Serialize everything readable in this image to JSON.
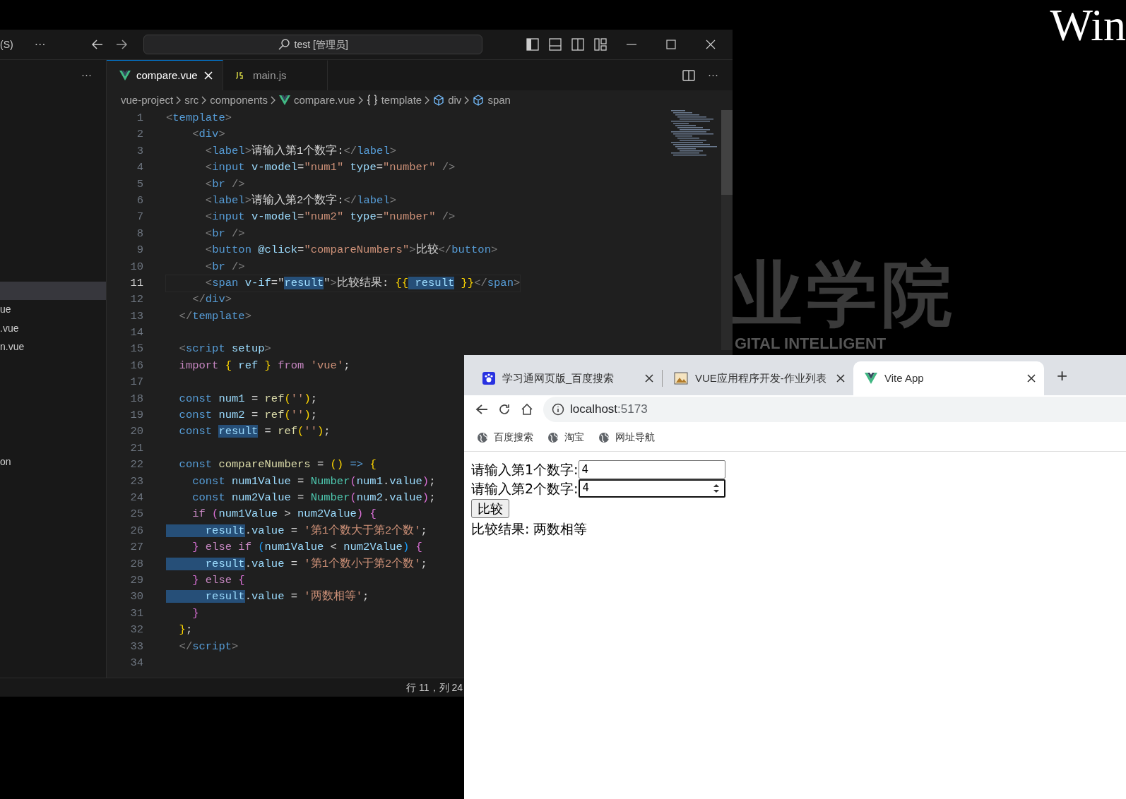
{
  "desktop": {
    "wallpaper_texts": [
      {
        "kind": "title",
        "text": "Win"
      },
      {
        "kind": "big",
        "text": "业学院"
      },
      {
        "kind": "sub",
        "text": "GITAL INTELLIGENT"
      }
    ]
  },
  "editor_window": {
    "menu_text": "(S)",
    "more": "···",
    "search": "test [管理员]",
    "sidebar": {
      "more": "···",
      "files": [
        {
          "label": "ue"
        },
        {
          "label": ".vue"
        },
        {
          "label": "n.vue"
        }
      ],
      "outline": [
        {
          "label": "on"
        }
      ]
    },
    "tabs": [
      {
        "label": "compare.vue",
        "kind": "vue",
        "selected": true
      },
      {
        "label": "main.js",
        "kind": "js",
        "selected": false
      }
    ],
    "tab_more": "···",
    "breadcrumb": [
      {
        "label": "vue-project",
        "kind": "folder"
      },
      {
        "label": "src",
        "kind": "folder"
      },
      {
        "label": "components",
        "kind": "folder"
      },
      {
        "label": "compare.vue",
        "kind": "vue"
      },
      {
        "label": "template",
        "kind": "braces"
      },
      {
        "label": "div",
        "kind": "element"
      },
      {
        "label": "span",
        "kind": "element"
      }
    ],
    "lines": [
      {
        "number": "1",
        "current": false,
        "tokens": [
          {
            "kind": "punct",
            "text": "<"
          },
          {
            "kind": "tag",
            "text": "template"
          },
          {
            "kind": "punct",
            "text": ">"
          }
        ]
      },
      {
        "number": "2",
        "current": false,
        "tokens": [
          {
            "kind": "punct",
            "text": "    <"
          },
          {
            "kind": "tag",
            "text": "div"
          },
          {
            "kind": "punct",
            "text": ">"
          }
        ]
      },
      {
        "number": "3",
        "current": false,
        "tokens": [
          {
            "kind": "punct",
            "text": "      <"
          },
          {
            "kind": "tag",
            "text": "label"
          },
          {
            "kind": "punct",
            "text": ">"
          },
          {
            "kind": "text",
            "text": "请输入第1个数字:"
          },
          {
            "kind": "punct",
            "text": "</"
          },
          {
            "kind": "tag",
            "text": "label"
          },
          {
            "kind": "punct",
            "text": ">"
          }
        ]
      },
      {
        "number": "4",
        "current": false,
        "tokens": [
          {
            "kind": "punct",
            "text": "      <"
          },
          {
            "kind": "tag",
            "text": "input"
          },
          {
            "kind": "attr",
            "text": " v-model"
          },
          {
            "kind": "plain",
            "text": "="
          },
          {
            "kind": "str",
            "text": "\"num1\""
          },
          {
            "kind": "attr",
            "text": " type"
          },
          {
            "kind": "plain",
            "text": "="
          },
          {
            "kind": "str",
            "text": "\"number\""
          },
          {
            "kind": "punct",
            "text": " />"
          }
        ]
      },
      {
        "number": "5",
        "current": false,
        "tokens": [
          {
            "kind": "punct",
            "text": "      <"
          },
          {
            "kind": "tag",
            "text": "br"
          },
          {
            "kind": "punct",
            "text": " />"
          }
        ]
      },
      {
        "number": "6",
        "current": false,
        "tokens": [
          {
            "kind": "punct",
            "text": "      <"
          },
          {
            "kind": "tag",
            "text": "label"
          },
          {
            "kind": "punct",
            "text": ">"
          },
          {
            "kind": "text",
            "text": "请输入第2个数字:"
          },
          {
            "kind": "punct",
            "text": "</"
          },
          {
            "kind": "tag",
            "text": "label"
          },
          {
            "kind": "punct",
            "text": ">"
          }
        ]
      },
      {
        "number": "7",
        "current": false,
        "tokens": [
          {
            "kind": "punct",
            "text": "      <"
          },
          {
            "kind": "tag",
            "text": "input"
          },
          {
            "kind": "attr",
            "text": " v-model"
          },
          {
            "kind": "plain",
            "text": "="
          },
          {
            "kind": "str",
            "text": "\"num2\""
          },
          {
            "kind": "attr",
            "text": " type"
          },
          {
            "kind": "plain",
            "text": "="
          },
          {
            "kind": "str",
            "text": "\"number\""
          },
          {
            "kind": "punct",
            "text": " />"
          }
        ]
      },
      {
        "number": "8",
        "current": false,
        "tokens": [
          {
            "kind": "punct",
            "text": "      <"
          },
          {
            "kind": "tag",
            "text": "br"
          },
          {
            "kind": "punct",
            "text": " />"
          }
        ]
      },
      {
        "number": "9",
        "current": false,
        "tokens": [
          {
            "kind": "punct",
            "text": "      <"
          },
          {
            "kind": "tag",
            "text": "button"
          },
          {
            "kind": "attr",
            "text": " @click"
          },
          {
            "kind": "plain",
            "text": "="
          },
          {
            "kind": "str",
            "text": "\"compareNumbers\""
          },
          {
            "kind": "punct",
            "text": ">"
          },
          {
            "kind": "text",
            "text": "比较"
          },
          {
            "kind": "punct",
            "text": "</"
          },
          {
            "kind": "tag",
            "text": "button"
          },
          {
            "kind": "punct",
            "text": ">"
          }
        ]
      },
      {
        "number": "10",
        "current": false,
        "tokens": [
          {
            "kind": "punct",
            "text": "      <"
          },
          {
            "kind": "tag",
            "text": "br"
          },
          {
            "kind": "punct",
            "text": " />"
          }
        ]
      },
      {
        "number": "11",
        "current": true,
        "tokens": [
          {
            "kind": "punct",
            "text": "      <"
          },
          {
            "kind": "tag",
            "text": "span"
          },
          {
            "kind": "attr",
            "text": " v-if"
          },
          {
            "kind": "plain",
            "text": "=\""
          },
          {
            "kind": "match",
            "text": "result"
          },
          {
            "kind": "plain",
            "text": "\""
          },
          {
            "kind": "punct",
            "text": ">"
          },
          {
            "kind": "text",
            "text": "比较结果: "
          },
          {
            "kind": "br1",
            "text": "{{"
          },
          {
            "kind": "match",
            "text": " result"
          },
          {
            "kind": "br1",
            "text": " }}"
          },
          {
            "kind": "punct",
            "text": "</"
          },
          {
            "kind": "tag",
            "text": "span"
          },
          {
            "kind": "punct",
            "text": ">"
          }
        ]
      },
      {
        "number": "12",
        "current": false,
        "tokens": [
          {
            "kind": "punct",
            "text": "    </"
          },
          {
            "kind": "tag",
            "text": "div"
          },
          {
            "kind": "punct",
            "text": ">"
          }
        ]
      },
      {
        "number": "13",
        "current": false,
        "tokens": [
          {
            "kind": "punct",
            "text": "  </"
          },
          {
            "kind": "tag",
            "text": "template"
          },
          {
            "kind": "punct",
            "text": ">"
          }
        ]
      },
      {
        "number": "14",
        "current": false
      },
      {
        "number": "15",
        "current": false,
        "tokens": [
          {
            "kind": "punct",
            "text": "  <"
          },
          {
            "kind": "tag",
            "text": "script"
          },
          {
            "kind": "attr",
            "text": " setup"
          },
          {
            "kind": "punct",
            "text": ">"
          }
        ]
      },
      {
        "number": "16",
        "current": false,
        "tokens": [
          {
            "kind": "ctrl",
            "text": "  import"
          },
          {
            "kind": "br1",
            "text": " {"
          },
          {
            "kind": "var",
            "text": " ref"
          },
          {
            "kind": "br1",
            "text": " }"
          },
          {
            "kind": "ctrl",
            "text": " from"
          },
          {
            "kind": "str",
            "text": " 'vue'"
          },
          {
            "kind": "plain",
            "text": ";"
          }
        ]
      },
      {
        "number": "17",
        "current": false
      },
      {
        "number": "18",
        "current": false,
        "tokens": [
          {
            "kind": "kw",
            "text": "  const"
          },
          {
            "kind": "var",
            "text": " num1"
          },
          {
            "kind": "plain",
            "text": " = "
          },
          {
            "kind": "fn",
            "text": "ref"
          },
          {
            "kind": "br1",
            "text": "("
          },
          {
            "kind": "str",
            "text": "''"
          },
          {
            "kind": "br1",
            "text": ")"
          },
          {
            "kind": "plain",
            "text": ";"
          }
        ]
      },
      {
        "number": "19",
        "current": false,
        "tokens": [
          {
            "kind": "kw",
            "text": "  const"
          },
          {
            "kind": "var",
            "text": " num2"
          },
          {
            "kind": "plain",
            "text": " = "
          },
          {
            "kind": "fn",
            "text": "ref"
          },
          {
            "kind": "br1",
            "text": "("
          },
          {
            "kind": "str",
            "text": "''"
          },
          {
            "kind": "br1",
            "text": ")"
          },
          {
            "kind": "plain",
            "text": ";"
          }
        ]
      },
      {
        "number": "20",
        "current": false,
        "tokens": [
          {
            "kind": "kw",
            "text": "  const "
          },
          {
            "kind": "match",
            "text": "result"
          },
          {
            "kind": "plain",
            "text": " = "
          },
          {
            "kind": "fn",
            "text": "ref"
          },
          {
            "kind": "br1",
            "text": "("
          },
          {
            "kind": "str",
            "text": "''"
          },
          {
            "kind": "br1",
            "text": ")"
          },
          {
            "kind": "plain",
            "text": ";"
          }
        ]
      },
      {
        "number": "21",
        "current": false
      },
      {
        "number": "22",
        "current": false,
        "tokens": [
          {
            "kind": "kw",
            "text": "  const"
          },
          {
            "kind": "fn",
            "text": " compareNumbers"
          },
          {
            "kind": "plain",
            "text": " = "
          },
          {
            "kind": "br1",
            "text": "()"
          },
          {
            "kind": "kw",
            "text": " =>"
          },
          {
            "kind": "br1",
            "text": " {"
          }
        ]
      },
      {
        "number": "23",
        "current": false,
        "tokens": [
          {
            "kind": "kw",
            "text": "    const"
          },
          {
            "kind": "var",
            "text": " num1Value"
          },
          {
            "kind": "plain",
            "text": " = "
          },
          {
            "kind": "cls",
            "text": "Number"
          },
          {
            "kind": "br2",
            "text": "("
          },
          {
            "kind": "var",
            "text": "num1"
          },
          {
            "kind": "plain",
            "text": "."
          },
          {
            "kind": "var",
            "text": "value"
          },
          {
            "kind": "br2",
            "text": ")"
          },
          {
            "kind": "plain",
            "text": ";"
          }
        ]
      },
      {
        "number": "24",
        "current": false,
        "tokens": [
          {
            "kind": "kw",
            "text": "    const"
          },
          {
            "kind": "var",
            "text": " num2Value"
          },
          {
            "kind": "plain",
            "text": " = "
          },
          {
            "kind": "cls",
            "text": "Number"
          },
          {
            "kind": "br2",
            "text": "("
          },
          {
            "kind": "var",
            "text": "num2"
          },
          {
            "kind": "plain",
            "text": "."
          },
          {
            "kind": "var",
            "text": "value"
          },
          {
            "kind": "br2",
            "text": ")"
          },
          {
            "kind": "plain",
            "text": ";"
          }
        ]
      },
      {
        "number": "25",
        "current": false,
        "tokens": [
          {
            "kind": "ctrl",
            "text": "    if"
          },
          {
            "kind": "br2",
            "text": " ("
          },
          {
            "kind": "var",
            "text": "num1Value"
          },
          {
            "kind": "plain",
            "text": " > "
          },
          {
            "kind": "var",
            "text": "num2Value"
          },
          {
            "kind": "br2",
            "text": ")"
          },
          {
            "kind": "br2",
            "text": " {"
          }
        ]
      },
      {
        "number": "26",
        "current": false,
        "tokens": [
          {
            "kind": "match",
            "text": "      result"
          },
          {
            "kind": "plain",
            "text": "."
          },
          {
            "kind": "var",
            "text": "value"
          },
          {
            "kind": "plain",
            "text": " = "
          },
          {
            "kind": "str",
            "text": "'第1个数大于第2个数'"
          },
          {
            "kind": "plain",
            "text": ";"
          }
        ]
      },
      {
        "number": "27",
        "current": false,
        "tokens": [
          {
            "kind": "br2",
            "text": "    }"
          },
          {
            "kind": "ctrl",
            "text": " else if"
          },
          {
            "kind": "br3",
            "text": " ("
          },
          {
            "kind": "var",
            "text": "num1Value"
          },
          {
            "kind": "plain",
            "text": " < "
          },
          {
            "kind": "var",
            "text": "num2Value"
          },
          {
            "kind": "br3",
            "text": ")"
          },
          {
            "kind": "br2",
            "text": " {"
          }
        ]
      },
      {
        "number": "28",
        "current": false,
        "tokens": [
          {
            "kind": "match",
            "text": "      result"
          },
          {
            "kind": "plain",
            "text": "."
          },
          {
            "kind": "var",
            "text": "value"
          },
          {
            "kind": "plain",
            "text": " = "
          },
          {
            "kind": "str",
            "text": "'第1个数小于第2个数'"
          },
          {
            "kind": "plain",
            "text": ";"
          }
        ]
      },
      {
        "number": "29",
        "current": false,
        "tokens": [
          {
            "kind": "br2",
            "text": "    }"
          },
          {
            "kind": "ctrl",
            "text": " else"
          },
          {
            "kind": "br2",
            "text": " {"
          }
        ]
      },
      {
        "number": "30",
        "current": false,
        "tokens": [
          {
            "kind": "match",
            "text": "      result"
          },
          {
            "kind": "plain",
            "text": "."
          },
          {
            "kind": "var",
            "text": "value"
          },
          {
            "kind": "plain",
            "text": " = "
          },
          {
            "kind": "str",
            "text": "'两数相等'"
          },
          {
            "kind": "plain",
            "text": ";"
          }
        ]
      },
      {
        "number": "31",
        "current": false,
        "tokens": [
          {
            "kind": "br2",
            "text": "    }"
          }
        ]
      },
      {
        "number": "32",
        "current": false,
        "tokens": [
          {
            "kind": "br1",
            "text": "  }"
          },
          {
            "kind": "plain",
            "text": ";"
          }
        ]
      },
      {
        "number": "33",
        "current": false,
        "tokens": [
          {
            "kind": "punct",
            "text": "  </"
          },
          {
            "kind": "tag",
            "text": "script"
          },
          {
            "kind": "punct",
            "text": ">"
          }
        ]
      },
      {
        "number": "34",
        "current": false
      }
    ],
    "status_bar": {
      "position": "行 11，列 24"
    }
  },
  "browser_window": {
    "tabs": [
      {
        "title": "学习通网页版_百度搜索",
        "kind": "paw",
        "selected": false
      },
      {
        "title": "VUE应用程序开发-作业列表",
        "kind": "image",
        "selected": false
      },
      {
        "title": "Vite App",
        "kind": "vue",
        "selected": true
      }
    ],
    "new_tab": "+",
    "address": {
      "host": "localhost",
      "port": ":5173"
    },
    "bookmarks": [
      {
        "label": "百度搜索"
      },
      {
        "label": "淘宝"
      },
      {
        "label": "网址导航"
      }
    ],
    "page": {
      "fields": [
        {
          "label": "请输入第1个数字:",
          "value": "4",
          "focused": false
        },
        {
          "label": "请输入第2个数字:",
          "value": "4",
          "focused": true
        }
      ],
      "button": "比较",
      "result": "比较结果: 两数相等"
    }
  }
}
